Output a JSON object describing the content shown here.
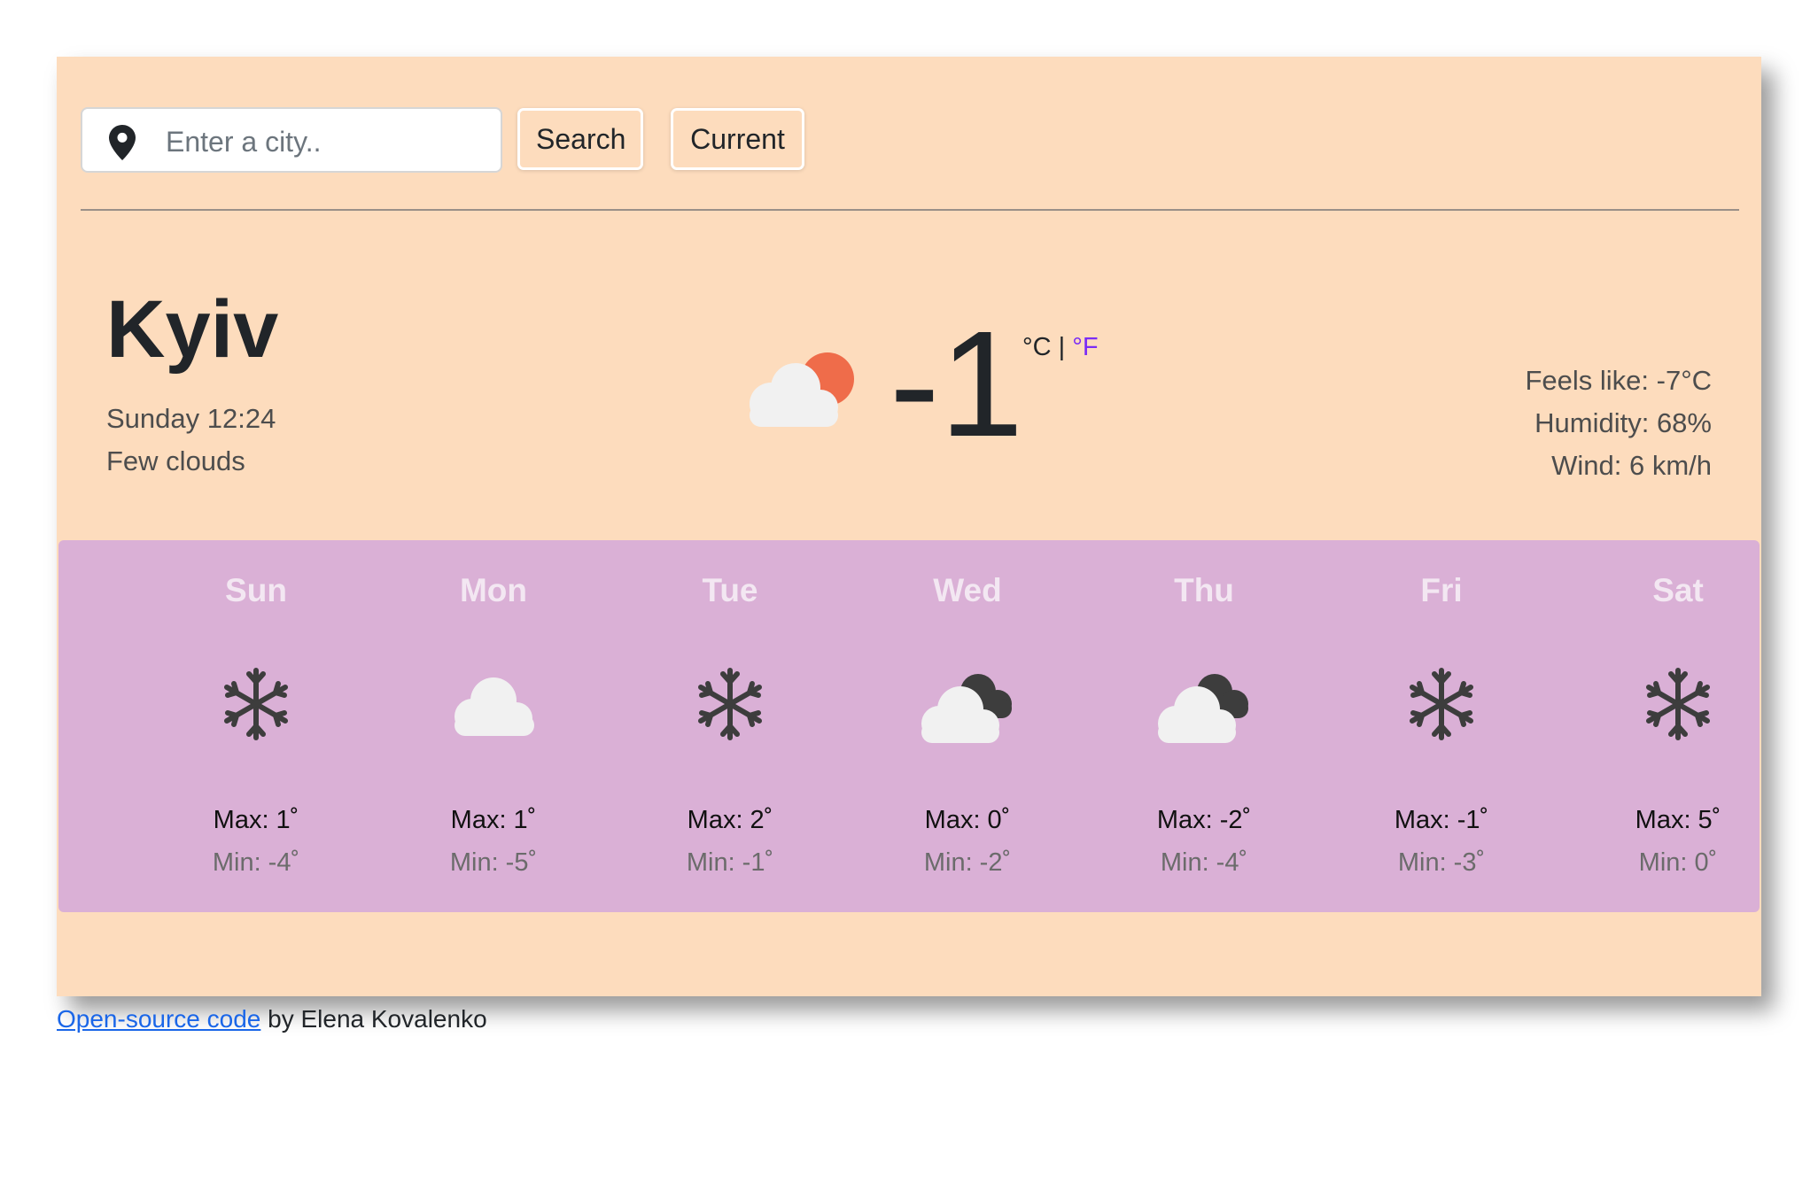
{
  "search": {
    "placeholder": "Enter a city..",
    "value": "",
    "search_label": "Search",
    "current_label": "Current"
  },
  "current": {
    "city": "Kyiv",
    "datetime": "Sunday 12:24",
    "description": "Few clouds",
    "temperature": "-1",
    "unit_c": "°C",
    "unit_sep": "|",
    "unit_f": "°F",
    "icon": "few-clouds-icon",
    "feels_like": "Feels like: -7°C",
    "humidity": "Humidity: 68%",
    "wind": "Wind: 6 km/h"
  },
  "forecast": [
    {
      "day": "Sun",
      "icon": "snow-icon",
      "max": "Max: 1˚",
      "min": "Min: -4˚"
    },
    {
      "day": "Mon",
      "icon": "cloud-icon",
      "max": "Max: 1˚",
      "min": "Min: -5˚"
    },
    {
      "day": "Tue",
      "icon": "snow-icon",
      "max": "Max: 2˚",
      "min": "Min: -1˚"
    },
    {
      "day": "Wed",
      "icon": "broken-clouds-icon",
      "max": "Max: 0˚",
      "min": "Min: -2˚"
    },
    {
      "day": "Thu",
      "icon": "broken-clouds-icon",
      "max": "Max: -2˚",
      "min": "Min: -4˚"
    },
    {
      "day": "Fri",
      "icon": "snow-icon",
      "max": "Max: -1˚",
      "min": "Min: -3˚"
    },
    {
      "day": "Sat",
      "icon": "snow-icon",
      "max": "Max: 5˚",
      "min": "Min: 0˚"
    }
  ],
  "footer": {
    "link_text": "Open-source code",
    "suffix": " by Elena Kovalenko"
  },
  "colors": {
    "app_bg": "#fddcbd",
    "forecast_bg": "#dab0d6",
    "sun": "#ef6c4a",
    "cloud_light": "#f1f1f1",
    "cloud_dark": "#3d3d3d",
    "link": "#1a66e8",
    "fahrenheit": "#7b2cf5"
  }
}
